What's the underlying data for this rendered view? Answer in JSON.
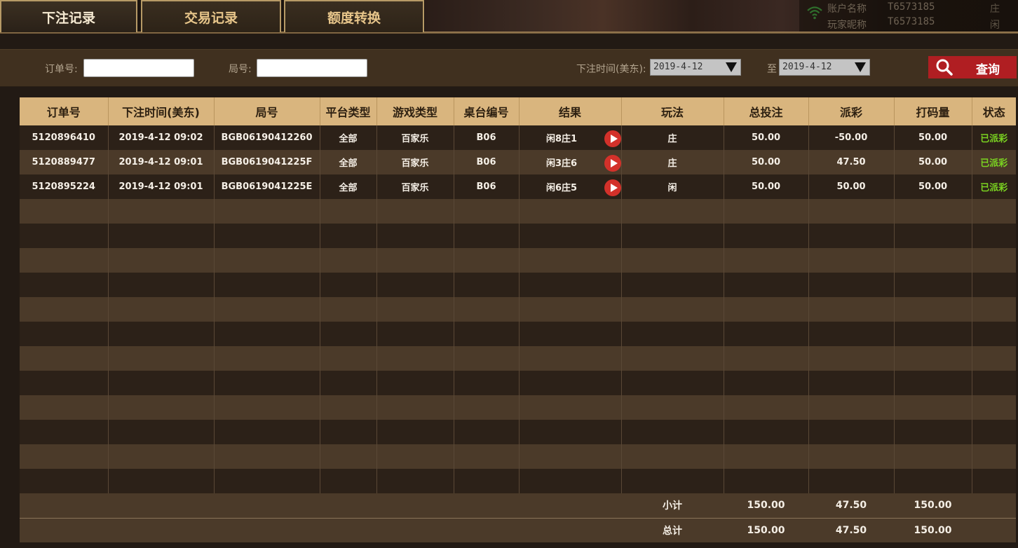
{
  "tabs": [
    {
      "label": "下注记录",
      "active": true
    },
    {
      "label": "交易记录",
      "active": false
    },
    {
      "label": "额度转换",
      "active": false
    }
  ],
  "account": {
    "account_name_label": "账户名称",
    "account_name_value": "T6573185",
    "nickname_label": "玩家昵称",
    "nickname_value": "T6573185",
    "side_banker": "庄",
    "side_player": "闲"
  },
  "search": {
    "order_label": "订单号:",
    "order_value": "",
    "round_label": "局号:",
    "round_value": "",
    "time_label": "下注时间(美东):",
    "date_from": "2019-4-12",
    "to_label": "至",
    "date_to": "2019-4-12",
    "query_label": "查询"
  },
  "table": {
    "columns": [
      "订单号",
      "下注时间(美东)",
      "局号",
      "平台类型",
      "游戏类型",
      "桌台编号",
      "结果",
      "玩法",
      "总投注",
      "派彩",
      "打码量",
      "状态"
    ],
    "rows": [
      {
        "order": "5120896410",
        "time": "2019-4-12 09:02",
        "round": "BGB06190412260",
        "platform": "全部",
        "game": "百家乐",
        "table": "B06",
        "result": "闲8庄1",
        "play": "庄",
        "bet": "50.00",
        "payout": "-50.00",
        "valid": "50.00",
        "status": "已派彩"
      },
      {
        "order": "5120889477",
        "time": "2019-4-12 09:01",
        "round": "BGB0619041225F",
        "platform": "全部",
        "game": "百家乐",
        "table": "B06",
        "result": "闲3庄6",
        "play": "庄",
        "bet": "50.00",
        "payout": "47.50",
        "valid": "50.00",
        "status": "已派彩"
      },
      {
        "order": "5120895224",
        "time": "2019-4-12 09:01",
        "round": "BGB0619041225E",
        "platform": "全部",
        "game": "百家乐",
        "table": "B06",
        "result": "闲6庄5",
        "play": "闲",
        "bet": "50.00",
        "payout": "50.00",
        "valid": "50.00",
        "status": "已派彩"
      }
    ],
    "subtotal": {
      "label": "小计",
      "bet": "150.00",
      "payout": "47.50",
      "valid": "150.00"
    },
    "total": {
      "label": "总计",
      "bet": "150.00",
      "payout": "47.50",
      "valid": "150.00"
    }
  },
  "colors": {
    "header_gold": "#d9b57e",
    "status_green": "#7ad321",
    "query_red": "#b01e22",
    "play_button_red": "#d3312a"
  }
}
